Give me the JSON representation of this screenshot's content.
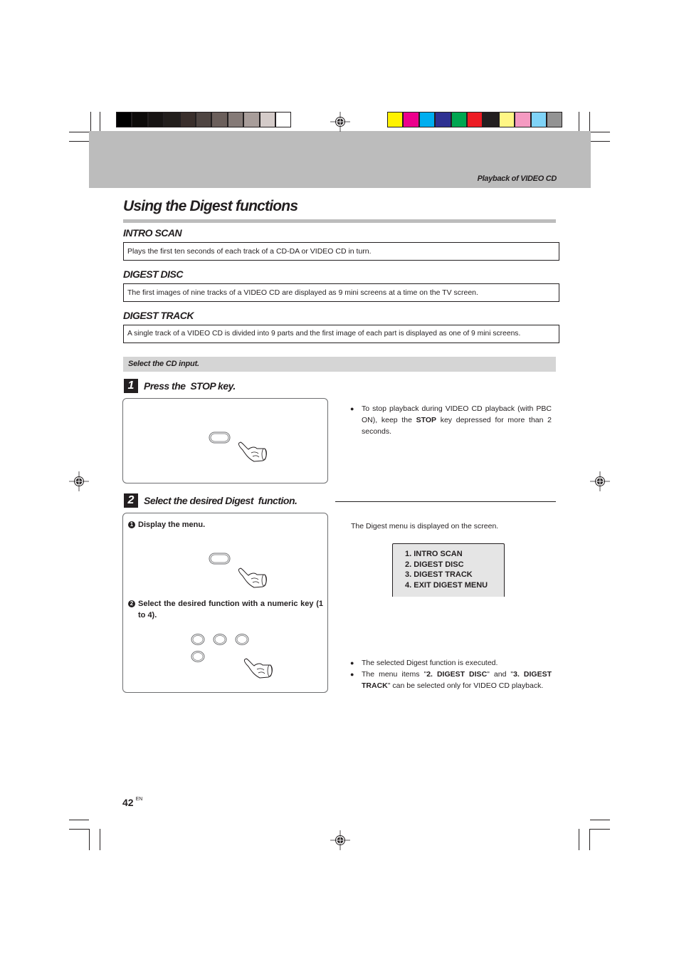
{
  "print_marks": {
    "gray_swatches": [
      "#000000",
      "#0d0b0a",
      "#171413",
      "#221e1c",
      "#3a2f2c",
      "#4f4542",
      "#6b5f5b",
      "#857a77",
      "#a89d9a",
      "#d4cbc9",
      "#ffffff"
    ],
    "color_swatches": [
      "#fff200",
      "#ec008c",
      "#00aeef",
      "#2e3192",
      "#00a651",
      "#ed1c24",
      "#231f20",
      "#fff685",
      "#f49ac1",
      "#7fd3f7",
      "#939393"
    ]
  },
  "header": {
    "section": "Playback of VIDEO CD"
  },
  "page": {
    "title": "Using the Digest functions",
    "number": "42",
    "lang": "EN"
  },
  "functions": [
    {
      "heading": "INTRO SCAN",
      "description": "Plays the first ten seconds of each track of a CD-DA or VIDEO CD in turn."
    },
    {
      "heading": "DIGEST DISC",
      "description": "The first images of nine tracks of a VIDEO CD are displayed as 9 mini screens at a time on the TV screen."
    },
    {
      "heading": "DIGEST TRACK",
      "description": "A single track of a VIDEO CD is divided into 9 parts and the first image of each part is displayed as one of 9 mini screens."
    }
  ],
  "prereq": "Select the CD input.",
  "steps": [
    {
      "number": "1",
      "title": "Press the  STOP key.",
      "notes": [
        {
          "pre": "To stop playback during VIDEO CD playback (with PBC ON), keep the ",
          "bold": "STOP",
          "post": " key depressed for more than 2 seconds."
        }
      ]
    },
    {
      "number": "2",
      "title": "Select the desired Digest  function.",
      "substeps": [
        {
          "marker": "1",
          "text": "Display the menu."
        },
        {
          "marker": "2",
          "text": "Select the desired function with a numeric key (1 to 4)."
        }
      ],
      "result": "The Digest menu is displayed on the screen.",
      "menu": [
        "1. INTRO SCAN",
        "2. DIGEST DISC",
        "3. DIGEST TRACK",
        "4. EXIT DIGEST MENU"
      ],
      "notes": [
        {
          "text": "The selected Digest function is executed."
        },
        {
          "pre": "The menu items \"",
          "bold1": "2. DIGEST DISC",
          "mid": "\" and \"",
          "bold2": "3. DIGEST TRACK",
          "post": "\" can be selected only for VIDEO CD playback."
        }
      ]
    }
  ]
}
